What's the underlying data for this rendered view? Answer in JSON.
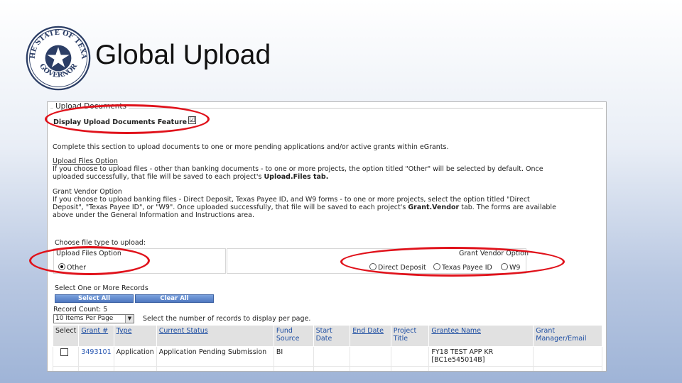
{
  "slide": {
    "title": "Global Upload",
    "seal_text_top": "THE STATE OF TEXAS",
    "seal_text_bottom": "GOVERNOR"
  },
  "upload": {
    "legend": "Upload Documents",
    "display_feature_label": "Display Upload Documents Feature",
    "display_feature_checked": true,
    "check_mark": "☑",
    "intro": "Complete this section to upload documents to one or more pending applications and/or active grants within eGrants.",
    "upload_files_heading": "Upload Files Option",
    "upload_files_text_1": "If you choose to upload files - other than banking documents - to one or more projects, the option titled \"Other\" will be selected by default. Once",
    "upload_files_text_2": "uploaded successfully, that file will be saved to each project's ",
    "upload_files_bold": "Upload.Files tab.",
    "grant_vendor_heading": "Grant Vendor Option",
    "grant_vendor_text_1": "If you choose to upload banking files - Direct Deposit, Texas Payee ID, and W9 forms - to one or more projects, select the option titled \"Direct",
    "grant_vendor_text_2a": "Deposit\", \"Texas Payee ID\", or \"W9\". Once uploaded successfully, that file will be saved to each project's ",
    "grant_vendor_bold": "Grant.Vendor",
    "grant_vendor_text_2b": " tab. The forms are available",
    "grant_vendor_text_3": "above under the General Information and Instructions area.",
    "file_type_label": "Choose file type to upload:",
    "upload_files_option_label": "Upload Files Option",
    "other_option": "Other",
    "grant_vendor_option_label": "Grant Vendor Option",
    "vendor_options": [
      "Direct Deposit",
      "Texas Payee ID",
      "W9"
    ],
    "select_records_label": "Select One or More Records",
    "select_all": "Select All",
    "clear_all": "Clear All",
    "record_count": "Record Count: 5",
    "per_page_selected": "10 Items Per Page",
    "per_page_hint": "Select the number of records to display per page."
  },
  "table": {
    "headers": [
      "Select",
      "Grant #",
      "Type",
      "Current Status",
      "Fund Source",
      "Start Date",
      "End Date",
      "Project Title",
      "Grantee Name",
      "Grant Manager/Email"
    ],
    "rows": [
      {
        "grant": "3493101",
        "type": "Application",
        "status": "Application Pending Submission",
        "fund": "BI",
        "start": "",
        "end": "",
        "title": "",
        "grantee": "FY18 TEST APP KR [BC1e545014B]",
        "manager": ""
      }
    ]
  },
  "colors": {
    "highlight": "#e0121b",
    "button": "#4f78c0",
    "link": "#2a58b2",
    "header_bg": "#e1e1e1"
  }
}
